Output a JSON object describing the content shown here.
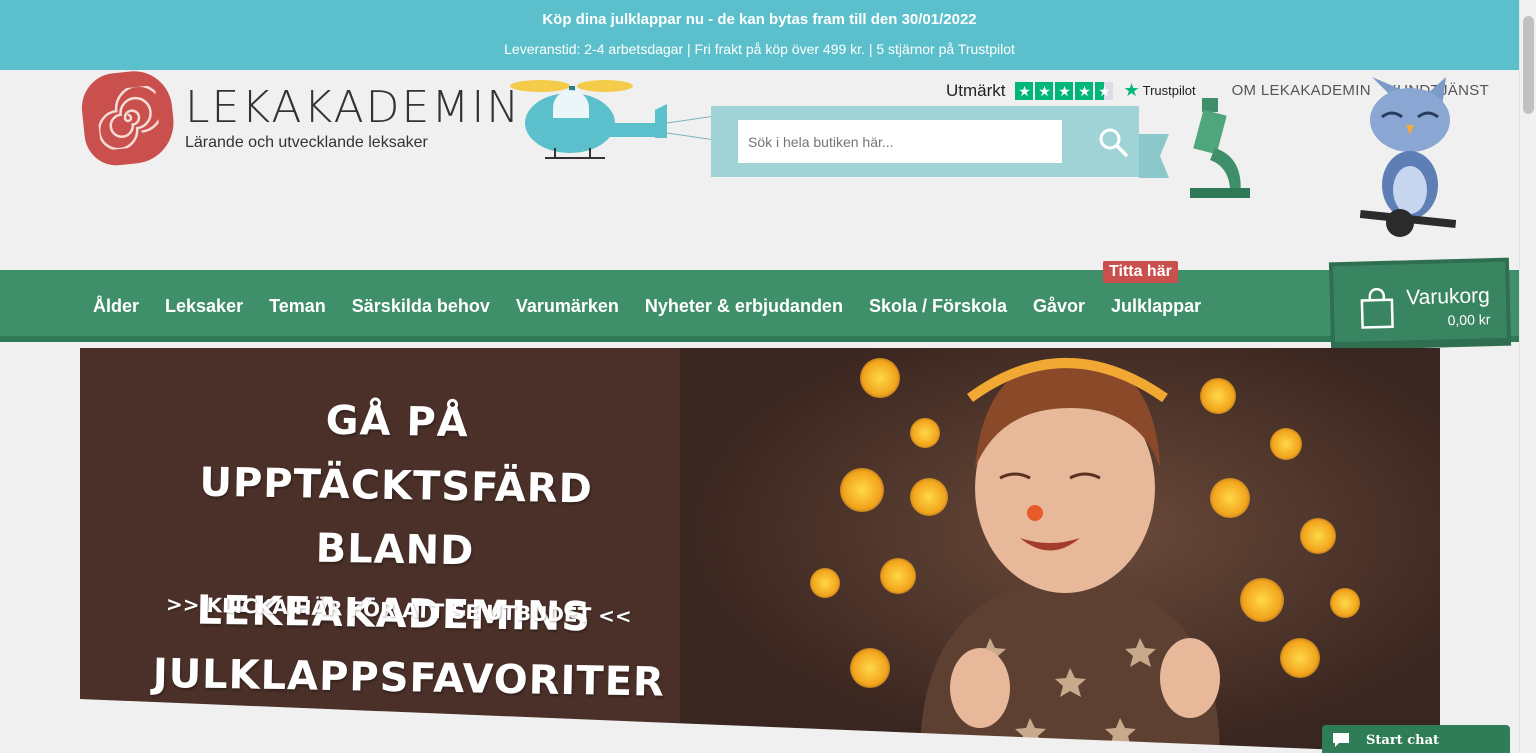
{
  "topbar": {
    "line1": "Köp dina julklappar nu - de kan bytas fram till den 30/01/2022",
    "line2": "Leveranstid: 2-4 arbetsdagar | Fri frakt på köp över 499 kr. | 5 stjärnor på Trustpilot"
  },
  "utility": {
    "trustpilot_rating_text": "Utmärkt",
    "trustpilot_brand": "Trustpilot",
    "trustpilot_stars": 4.5,
    "about_link": "OM LEKAKADEMIN",
    "support_link": "KUNDTJÄNST"
  },
  "logo": {
    "name": "LEKAKADEMIN",
    "tagline": "Lärande och utvecklande leksaker"
  },
  "search": {
    "placeholder": "Sök i hela butiken här..."
  },
  "nav": {
    "items": [
      {
        "label": "Ålder"
      },
      {
        "label": "Leksaker"
      },
      {
        "label": "Teman"
      },
      {
        "label": "Särskilda behov"
      },
      {
        "label": "Varumärken"
      },
      {
        "label": "Nyheter & erbjudanden"
      },
      {
        "label": "Skola / Förskola"
      },
      {
        "label": "Gåvor"
      },
      {
        "label": "Julklappar"
      }
    ],
    "promo_badge": "Titta här"
  },
  "cart": {
    "label": "Varukorg",
    "total": "0,00 kr"
  },
  "hero": {
    "title_line1": "GÅ PÅ UPPTÄCKTSFÄRD",
    "title_line2": "BLAND LEKEAKADEMINS",
    "title_line3": "JULKLAPPSFAVORITER",
    "cta": ">> KLICKA HÄR FÖR ATT SE UTBUDET <<"
  },
  "chat": {
    "label": "Start chat"
  },
  "colors": {
    "topbar": "#5bc0cb",
    "nav": "#3f8f6a",
    "accent_red": "#c9504d",
    "trustpilot_green": "#00b67a"
  }
}
